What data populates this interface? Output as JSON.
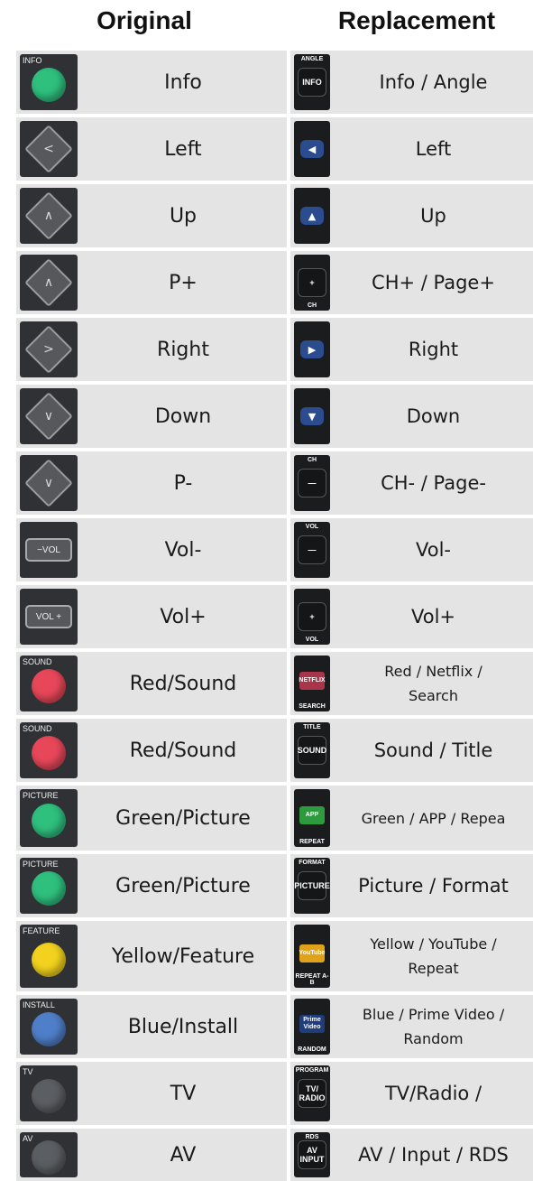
{
  "headers": {
    "original": "Original",
    "replacement": "Replacement"
  },
  "rows": [
    {
      "original": "Info",
      "replacement": "Info / Angle",
      "orig_icon": "green-info-button-icon",
      "repl_icon": "info-angle-button-icon",
      "orig_tag": "INFO",
      "repl_top": "ANGLE",
      "repl_key": "INFO"
    },
    {
      "original": "Left",
      "replacement": "Left",
      "orig_icon": "left-arrow-button-icon",
      "repl_icon": "blue-left-arrow-button-icon",
      "orig_glyph": "<",
      "repl_glyph": "◀"
    },
    {
      "original": "Up",
      "replacement": "Up",
      "orig_icon": "up-arrow-button-icon",
      "repl_icon": "blue-up-arrow-button-icon",
      "orig_glyph": "∧",
      "repl_glyph": "▲"
    },
    {
      "original": "P+",
      "replacement": "CH+ / Page+",
      "orig_icon": "program-up-button-icon",
      "repl_icon": "channel-plus-button-icon",
      "orig_glyph": "∧",
      "repl_key": "+",
      "repl_bottom": "CH"
    },
    {
      "original": "Right",
      "replacement": "Right",
      "orig_icon": "right-arrow-button-icon",
      "repl_icon": "blue-right-arrow-button-icon",
      "orig_glyph": ">",
      "repl_glyph": "▶"
    },
    {
      "original": "Down",
      "replacement": "Down",
      "orig_icon": "down-arrow-button-icon",
      "repl_icon": "blue-down-arrow-button-icon",
      "orig_glyph": "∨",
      "repl_glyph": "▼"
    },
    {
      "original": "P-",
      "replacement": "CH- / Page-",
      "orig_icon": "program-down-button-icon",
      "repl_icon": "channel-minus-button-icon",
      "orig_glyph": "∨",
      "repl_top": "CH",
      "repl_key": "—"
    },
    {
      "original": "Vol-",
      "replacement": "Vol-",
      "orig_icon": "volume-down-button-icon",
      "repl_icon": "volume-minus-button-icon",
      "orig_tag": "−VOL",
      "repl_top": "VOL",
      "repl_key": "—"
    },
    {
      "original": "Vol+",
      "replacement": "Vol+",
      "orig_icon": "volume-up-button-icon",
      "repl_icon": "volume-plus-button-icon",
      "orig_tag": "VOL +",
      "repl_key": "+",
      "repl_bottom": "VOL"
    },
    {
      "original": "Red/Sound",
      "replacement": "Red / Netflix /\nSearch",
      "orig_icon": "red-sound-button-icon",
      "repl_icon": "netflix-button-icon",
      "orig_tag": "SOUND",
      "repl_key": "NETFLIX",
      "repl_bottom": "SEARCH",
      "repl_color": "#a8354a"
    },
    {
      "original": "Red/Sound",
      "replacement": "Sound / Title",
      "orig_icon": "red-sound-button-icon",
      "repl_icon": "sound-title-button-icon",
      "orig_tag": "SOUND",
      "repl_top": "TITLE",
      "repl_key": "SOUND"
    },
    {
      "original": "Green/Picture",
      "replacement": "Green / APP / Repea",
      "orig_icon": "green-picture-button-icon",
      "repl_icon": "app-button-icon",
      "orig_tag": "PICTURE",
      "repl_key": "APP",
      "repl_bottom": "REPEAT",
      "repl_color": "#2e9a3e"
    },
    {
      "original": "Green/Picture",
      "replacement": "Picture / Format",
      "orig_icon": "green-picture-button-icon",
      "repl_icon": "picture-format-button-icon",
      "orig_tag": "PICTURE",
      "repl_top": "FORMAT",
      "repl_key": "PICTURE"
    },
    {
      "original": "Yellow/Feature",
      "replacement": "Yellow / YouTube /\nRepeat",
      "orig_icon": "yellow-feature-button-icon",
      "repl_icon": "youtube-button-icon",
      "orig_tag": "FEATURE",
      "repl_key": "YouTube",
      "repl_bottom": "REPEAT A-B",
      "repl_color": "#e0a21a"
    },
    {
      "original": "Blue/Install",
      "replacement": "Blue / Prime Video /\nRandom",
      "orig_icon": "blue-install-button-icon",
      "repl_icon": "prime-video-button-icon",
      "orig_tag": "INSTALL",
      "repl_key": "Prime Video",
      "repl_bottom": "RANDOM",
      "repl_color": "#1f3d7a"
    },
    {
      "original": "TV",
      "replacement": "TV/Radio /",
      "orig_icon": "tv-button-icon",
      "repl_icon": "tv-radio-button-icon",
      "orig_tag": "TV",
      "repl_top": "PROGRAM",
      "repl_key": "TV/ RADIO"
    },
    {
      "original": "AV",
      "replacement": "AV / Input / RDS",
      "orig_icon": "av-button-icon",
      "repl_icon": "av-input-button-icon",
      "orig_tag": "AV",
      "repl_top": "RDS",
      "repl_key": "AV INPUT"
    }
  ],
  "colors": {
    "cell_bg": "#e4e4e4",
    "green": "#2fc07e",
    "red": "#e8475a",
    "yellow": "#f2d21e",
    "blue": "#4f7fc9",
    "grey": "#5b5e62"
  }
}
